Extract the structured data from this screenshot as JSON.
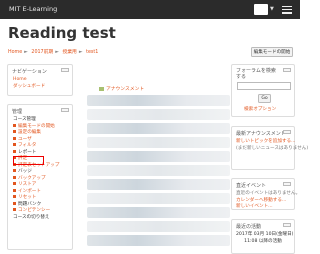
{
  "header": {
    "brand": "MIT E-Learning",
    "user_caret": "▼"
  },
  "page": {
    "title": "Reading test",
    "breadcrumb": [
      "Home",
      "2017前期",
      "授業用",
      "test1"
    ],
    "edit_button": "編集モードの開始"
  },
  "navigation": {
    "title": "ナビゲーション",
    "items": [
      "Home",
      "ダッシュボード",
      "サイトページ",
      "現在のコース",
      "マイコース"
    ]
  },
  "admin": {
    "title": "管理",
    "section": "コース管理",
    "items": [
      "編集モードの開始",
      "設定の編集",
      "ユーザ",
      "フィルタ",
      "レポート",
      "評定",
      "評定表セットアップ",
      "バッジ",
      "バックアップ",
      "リストア",
      "インポート",
      "リセット",
      "問題バンク",
      "コンピテンシー",
      "コースの切り替え"
    ]
  },
  "main": {
    "news_link": "アナウンスメント"
  },
  "forum": {
    "title": "フォーラムを検索する",
    "go_label": "Go",
    "advanced": "検索オプション"
  },
  "latest": {
    "title": "最新アナウンスメント",
    "line1": "新しいトピックを追加する...",
    "line2": "(まだ新しいニュースはありません)"
  },
  "events": {
    "title": "直近イベント",
    "line1": "直近のイベントはありません。",
    "line2": "カレンダーへ移動する...",
    "line3": "新しいイベント..."
  },
  "recent": {
    "title": "最近の活動",
    "line1": "2017年 03月 10日(金曜日)",
    "line2": "11:08 以降の活動"
  },
  "colors": {
    "accent": "#e2561f",
    "navbar": "#2b2b2b",
    "highlight": "#e00000"
  }
}
